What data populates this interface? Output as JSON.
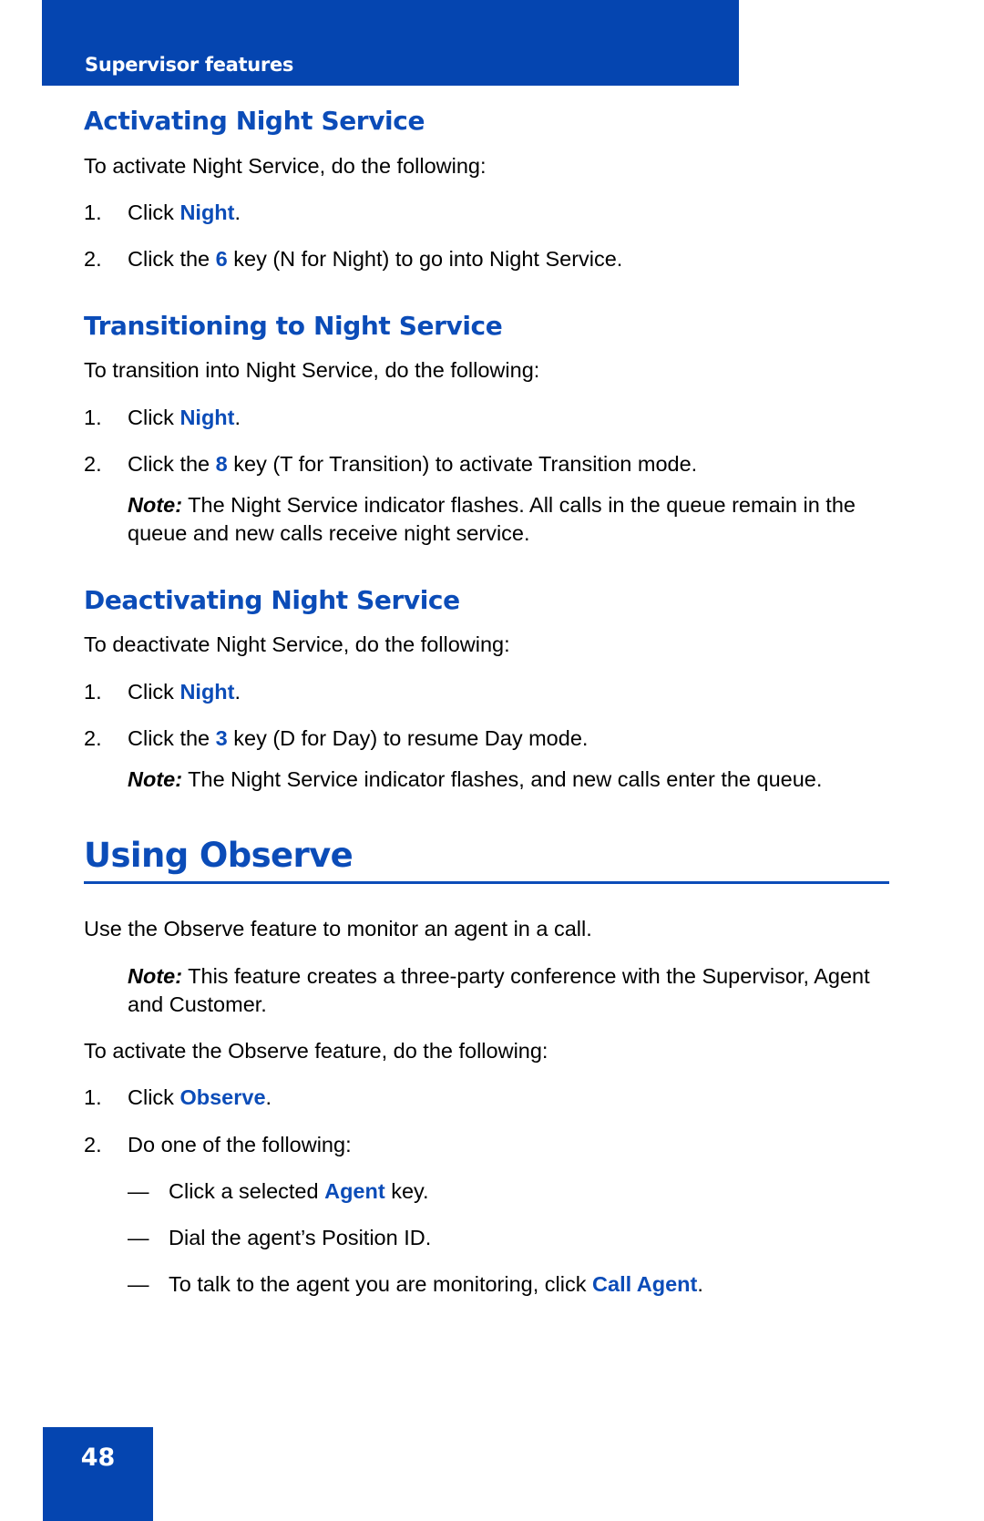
{
  "header": {
    "title": "Supervisor features"
  },
  "sections": [
    {
      "id": "activating-night-service",
      "heading": "Activating Night Service",
      "intro": "To activate Night Service, do the following:",
      "steps": [
        {
          "num": "1.",
          "pre": "Click ",
          "kw": "Night",
          "post": "."
        },
        {
          "num": "2.",
          "pre": "Click the ",
          "kw": "6",
          "post": " key (N for Night) to go into Night Service."
        }
      ]
    },
    {
      "id": "transitioning-to-night-service",
      "heading": "Transitioning to Night Service",
      "intro": "To transition into Night Service, do the following:",
      "steps": [
        {
          "num": "1.",
          "pre": "Click ",
          "kw": "Night",
          "post": "."
        },
        {
          "num": "2.",
          "pre": "Click the ",
          "kw": "8",
          "post": " key (T for Transition) to activate Transition mode."
        }
      ],
      "note": {
        "label": "Note:",
        "text": " The Night Service indicator flashes. All calls in the queue remain in the queue and new calls receive night service."
      }
    },
    {
      "id": "deactivating-night-service",
      "heading": "Deactivating Night Service",
      "intro": "To deactivate Night Service, do the following:",
      "steps": [
        {
          "num": "1.",
          "pre": "Click ",
          "kw": "Night",
          "post": "."
        },
        {
          "num": "2.",
          "pre": "Click the ",
          "kw": "3",
          "post": " key (D for Day) to resume Day mode."
        }
      ],
      "note": {
        "label": "Note:",
        "text": " The Night Service indicator flashes, and new calls enter the queue."
      }
    }
  ],
  "chapter": {
    "id": "using-observe",
    "heading": "Using Observe",
    "intro": "Use the Observe feature to monitor an agent in a call.",
    "note": {
      "label": "Note:",
      "text": " This feature creates a three-party conference with the Supervisor, Agent and Customer."
    },
    "lead": "To activate the Observe feature, do the following:",
    "steps": [
      {
        "num": "1.",
        "pre": "Click ",
        "kw": "Observe",
        "post": "."
      },
      {
        "num": "2.",
        "pre": "Do one of the following:",
        "kw": "",
        "post": ""
      }
    ],
    "bullets": [
      {
        "dash": "—",
        "pre": "Click a selected ",
        "kw": "Agent",
        "post": " key."
      },
      {
        "dash": "—",
        "pre": "Dial the agent’s Position ID.",
        "kw": "",
        "post": ""
      },
      {
        "dash": "—",
        "pre": "To talk to the agent you are monitoring, click ",
        "kw": "Call Agent",
        "post": "."
      }
    ]
  },
  "footer": {
    "page_number": "48"
  },
  "colors": {
    "brand_blue": "#0545b0",
    "heading_blue": "#0b4cb8",
    "text_black": "#000000",
    "page_white": "#ffffff"
  }
}
